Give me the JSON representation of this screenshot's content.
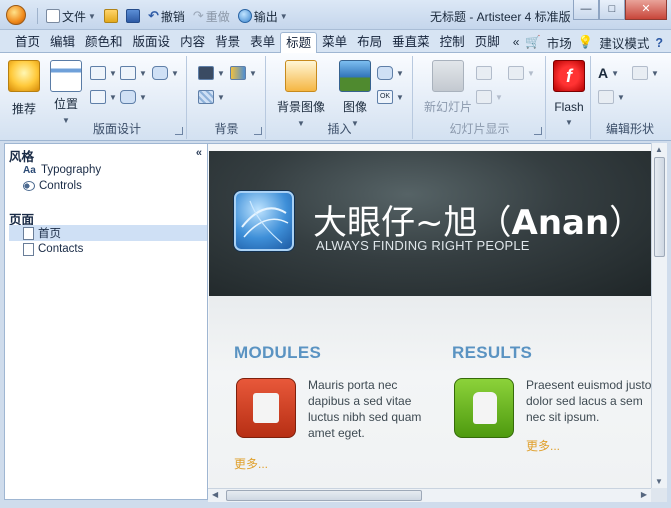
{
  "titlebar": {
    "quick_access": {
      "file": "文件",
      "undo": "撤销",
      "redo": "重做",
      "export": "输出"
    },
    "window_title": "无标题 - Artisteer 4 标准版",
    "controls": {
      "minimize": "—",
      "maximize": "□",
      "close": "✕"
    }
  },
  "tabs": {
    "items": [
      "首页",
      "编辑",
      "颜色和",
      "版面设",
      "内容",
      "背景",
      "表单",
      "标题",
      "菜单",
      "布局",
      "垂直菜",
      "控制",
      "页脚"
    ],
    "active": "标题",
    "more": "«",
    "market": "市场",
    "suggest_mode": "建议模式"
  },
  "ribbon": {
    "groups": {
      "layout": {
        "label": "版面设计",
        "recommend": "推荐",
        "position": "位置"
      },
      "background": {
        "label": "背景"
      },
      "insert": {
        "label": "插入",
        "bg_image": "背景图像",
        "image": "图像"
      },
      "slideshow": {
        "label": "幻灯片显示",
        "new_slide": "新幻灯片"
      },
      "flash": {
        "label": "Flash"
      },
      "edit_shape": {
        "label": "编辑形状"
      }
    }
  },
  "left_pane": {
    "collapse": "«",
    "style_heading": "风格",
    "style_items": [
      "Typography",
      "Controls"
    ],
    "style_icon_text": "Aa",
    "pages_heading": "页面",
    "pages": [
      "首页",
      "Contacts"
    ],
    "selected_page": "首页"
  },
  "preview": {
    "header": {
      "title_cn": "大眼仔~旭（",
      "title_en": "Anan",
      "title_end": "）",
      "slogan": "ALWAYS FINDING RIGHT PEOPLE"
    },
    "modules": {
      "title": "MODULES",
      "text": "Mauris porta nec dapibus a sed vitae luctus nibh sed quam amet eget.",
      "more": "更多..."
    },
    "results": {
      "title": "RESULTS",
      "text": "Praesent euismod justo dolor sed lacus a sem nec sit ipsum.",
      "more": "更多..."
    }
  },
  "colors": {
    "accent_blue": "#5a93c2",
    "more_link": "#e0a02c",
    "hero_bg": "#353e41"
  }
}
